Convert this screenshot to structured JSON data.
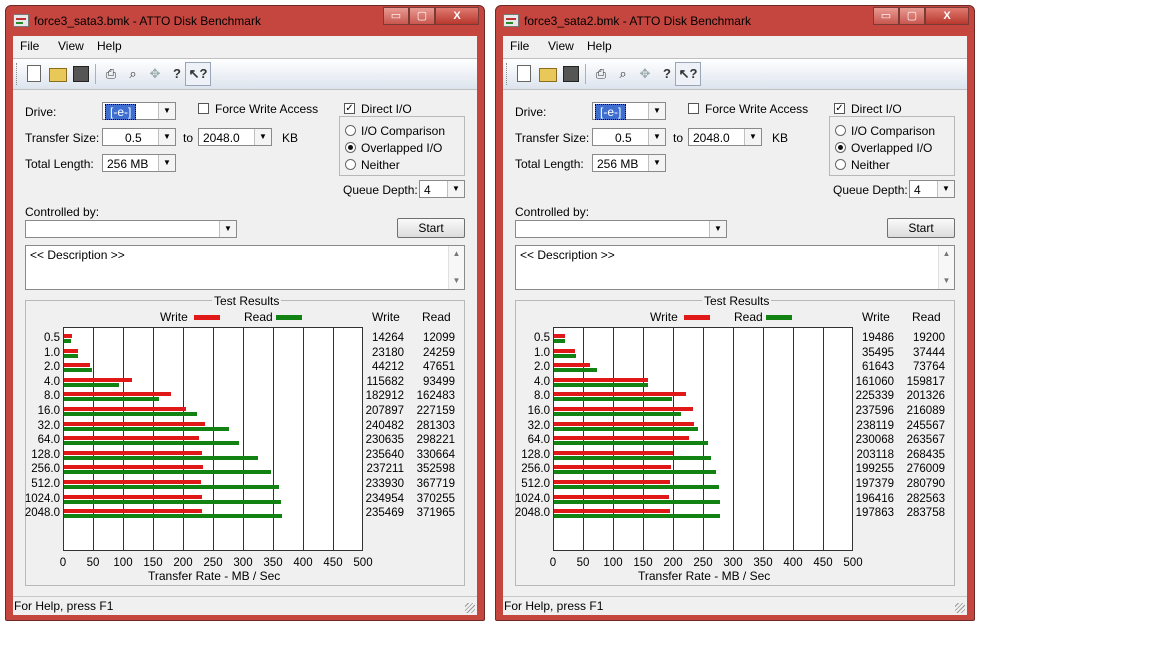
{
  "windows": [
    {
      "title": "force3_sata3.bmk - ATTO Disk Benchmark",
      "window_buttons": {
        "minimize": "▭",
        "maximize": "▢",
        "close": "X"
      },
      "menu": [
        "File",
        "View",
        "Help"
      ],
      "toolbar_icons": [
        "new-icon",
        "open-icon",
        "save-icon",
        "print-icon",
        "print-preview-icon",
        "move-icon",
        "help-icon",
        "context-help-icon"
      ],
      "drive_label": "Drive:",
      "drive_value": "[-e-]",
      "force_write_label": "Force Write Access",
      "force_write_checked": false,
      "direct_io_label": "Direct I/O",
      "direct_io_checked": true,
      "transfer_size_label": "Transfer Size:",
      "transfer_from": "0.5",
      "to_label": "to",
      "transfer_to": "2048.0",
      "kb_label": "KB",
      "total_length_label": "Total Length:",
      "total_length": "256 MB",
      "io_options": [
        "I/O Comparison",
        "Overlapped I/O",
        "Neither"
      ],
      "io_selected": 1,
      "queue_depth_label": "Queue Depth:",
      "queue_depth": "4",
      "controlled_by_label": "Controlled by:",
      "controlled_by": "",
      "start_label": "Start",
      "description": "<< Description >>",
      "results_title": "Test Results",
      "legend_write": "Write",
      "legend_read": "Read",
      "col_write": "Write",
      "col_read": "Read",
      "axis_title": "Transfer Rate - MB / Sec",
      "status_text": "For Help, press F1",
      "colors": {
        "write": "#e01818",
        "read": "#128212",
        "grid": "#1c2a8a",
        "frame": "#c4463f"
      },
      "chart_data": {
        "type": "bar",
        "orientation": "horizontal",
        "categories": [
          "0.5",
          "1.0",
          "2.0",
          "4.0",
          "8.0",
          "16.0",
          "32.0",
          "64.0",
          "128.0",
          "256.0",
          "512.0",
          "1024.0",
          "2048.0"
        ],
        "xlim": [
          0,
          500
        ],
        "xticks": [
          "0",
          "50",
          "100",
          "150",
          "200",
          "250",
          "300",
          "350",
          "400",
          "450",
          "500"
        ],
        "xlabel": "Transfer Rate - MB / Sec",
        "series": [
          {
            "name": "Write",
            "values": [
              14264,
              23180,
              44212,
              115682,
              182912,
              207897,
              240482,
              230635,
              235640,
              237211,
              233930,
              234954,
              235469
            ]
          },
          {
            "name": "Read",
            "values": [
              12099,
              24259,
              47651,
              93499,
              162483,
              227159,
              281303,
              298221,
              330664,
              352598,
              367719,
              370255,
              371965
            ]
          }
        ]
      }
    },
    {
      "title": "force3_sata2.bmk - ATTO Disk Benchmark",
      "window_buttons": {
        "minimize": "▭",
        "maximize": "▢",
        "close": "X"
      },
      "menu": [
        "File",
        "View",
        "Help"
      ],
      "toolbar_icons": [
        "new-icon",
        "open-icon",
        "save-icon",
        "print-icon",
        "print-preview-icon",
        "move-icon",
        "help-icon",
        "context-help-icon"
      ],
      "drive_label": "Drive:",
      "drive_value": "[-e-]",
      "force_write_label": "Force Write Access",
      "force_write_checked": false,
      "direct_io_label": "Direct I/O",
      "direct_io_checked": true,
      "transfer_size_label": "Transfer Size:",
      "transfer_from": "0.5",
      "to_label": "to",
      "transfer_to": "2048.0",
      "kb_label": "KB",
      "total_length_label": "Total Length:",
      "total_length": "256 MB",
      "io_options": [
        "I/O Comparison",
        "Overlapped I/O",
        "Neither"
      ],
      "io_selected": 1,
      "queue_depth_label": "Queue Depth:",
      "queue_depth": "4",
      "controlled_by_label": "Controlled by:",
      "controlled_by": "",
      "start_label": "Start",
      "description": "<< Description >>",
      "results_title": "Test Results",
      "legend_write": "Write",
      "legend_read": "Read",
      "col_write": "Write",
      "col_read": "Read",
      "axis_title": "Transfer Rate - MB / Sec",
      "status_text": "For Help, press F1",
      "colors": {
        "write": "#e01818",
        "read": "#128212",
        "grid": "#1c2a8a",
        "frame": "#c4463f"
      },
      "chart_data": {
        "type": "bar",
        "orientation": "horizontal",
        "categories": [
          "0.5",
          "1.0",
          "2.0",
          "4.0",
          "8.0",
          "16.0",
          "32.0",
          "64.0",
          "128.0",
          "256.0",
          "512.0",
          "1024.0",
          "2048.0"
        ],
        "xlim": [
          0,
          500
        ],
        "xticks": [
          "0",
          "50",
          "100",
          "150",
          "200",
          "250",
          "300",
          "350",
          "400",
          "450",
          "500"
        ],
        "xlabel": "Transfer Rate - MB / Sec",
        "series": [
          {
            "name": "Write",
            "values": [
              19486,
              35495,
              61643,
              161060,
              225339,
              237596,
              238119,
              230068,
              203118,
              199255,
              197379,
              196416,
              197863
            ]
          },
          {
            "name": "Read",
            "values": [
              19200,
              37444,
              73764,
              159817,
              201326,
              216089,
              245567,
              263567,
              268435,
              276009,
              280790,
              282563,
              283758
            ]
          }
        ]
      }
    }
  ]
}
